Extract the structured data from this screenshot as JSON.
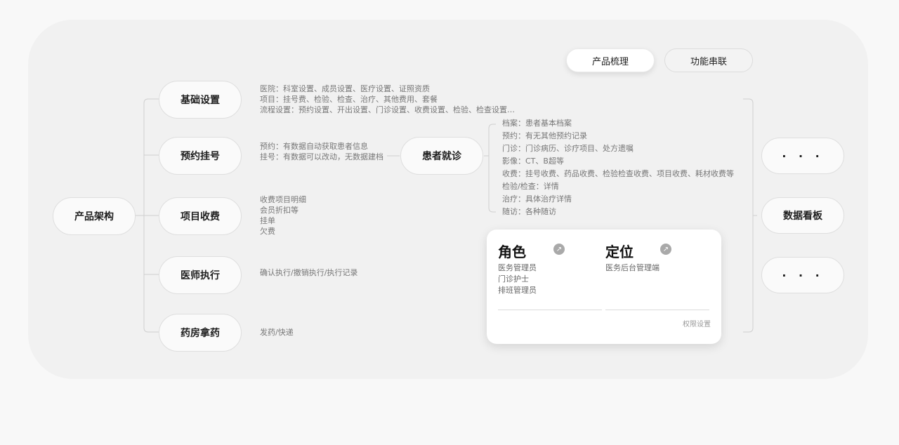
{
  "tabs": {
    "product": "产品梳理",
    "function": "功能串联"
  },
  "root": "产品架构",
  "modules": [
    {
      "label": "基础设置",
      "desc": [
        "医院：科室设置、成员设置、医疗设置、证照资质",
        "项目：挂号费、检验、检查、治疗、其他费用、套餐",
        "流程设置：预约设置、开出设置、门诊设置、收费设置、检验、检查设置…"
      ]
    },
    {
      "label": "预约挂号",
      "desc": [
        "预约：有数据自动获取患者信息",
        "挂号：有数据可以改动，无数据建档"
      ]
    },
    {
      "label": "项目收费",
      "desc": [
        "收费项目明细",
        "会员折扣等",
        "挂单",
        "欠费"
      ]
    },
    {
      "label": "医师执行",
      "desc": [
        "确认执行/撤销执行/执行记录"
      ]
    },
    {
      "label": "药房拿药",
      "desc": [
        "发药/快递"
      ]
    }
  ],
  "patient": {
    "label": "患者就诊",
    "items": [
      "档案：患者基本档案",
      "预约：有无其他预约记录",
      "门诊：门诊病历、诊疗项目、处方遗嘱",
      "影像：CT、B超等",
      "收费：挂号收费、药品收费、检验检查收费、项目收费、耗材收费等",
      "检验/检查：详情",
      "治疗：具体治疗详情",
      "随访：各种随访"
    ]
  },
  "card": {
    "role_title": "角色",
    "roles": [
      "医务管理员",
      "门诊护士",
      "排班管理员"
    ],
    "position_title": "定位",
    "positions": [
      "医务后台管理端"
    ],
    "permission": "权限设置",
    "arrow_icon": "↗"
  },
  "right": {
    "more_top": "· · ·",
    "dashboard": "数据看板",
    "more_bottom": "· · ·"
  }
}
